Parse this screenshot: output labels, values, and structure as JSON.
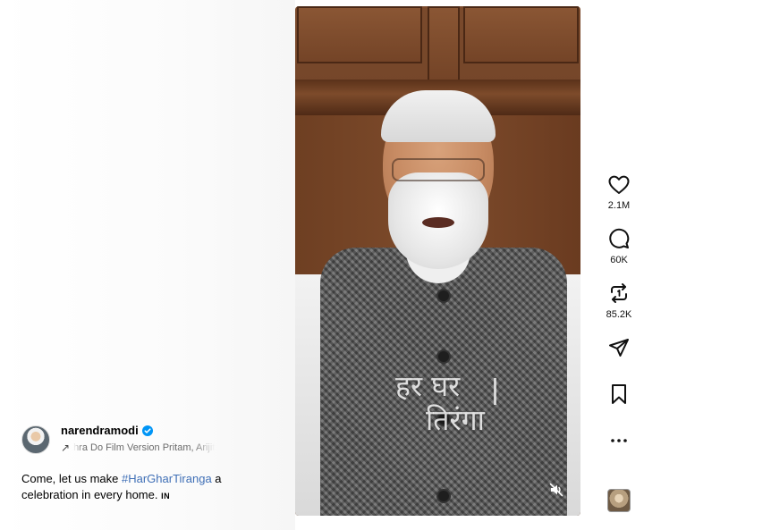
{
  "post": {
    "username": "narendramodi",
    "verified": true,
    "audio_text": "hra Do Film Version  Pritam, Arijit",
    "caption_pre": "Come, let us make ",
    "caption_hashtag": "#HarGharTiranga",
    "caption_post": " a celebration in every home. ",
    "caption_flag": "IN"
  },
  "video": {
    "overlay_line_1": "हर घर",
    "overlay_line_2": "तिरंगा",
    "muted": true
  },
  "actions": {
    "like_count": "2.1M",
    "comment_count": "60K",
    "repost_count": "85.2K"
  },
  "icons": {
    "like": "heart-icon",
    "comment": "comment-icon",
    "repost": "repost-icon",
    "share": "send-icon",
    "save": "bookmark-icon",
    "more": "more-icon",
    "mute": "speaker-muted-icon",
    "verified": "verified-badge-icon"
  },
  "colors": {
    "verified_blue": "#0095f6",
    "hashtag": "#3f6fb6"
  }
}
